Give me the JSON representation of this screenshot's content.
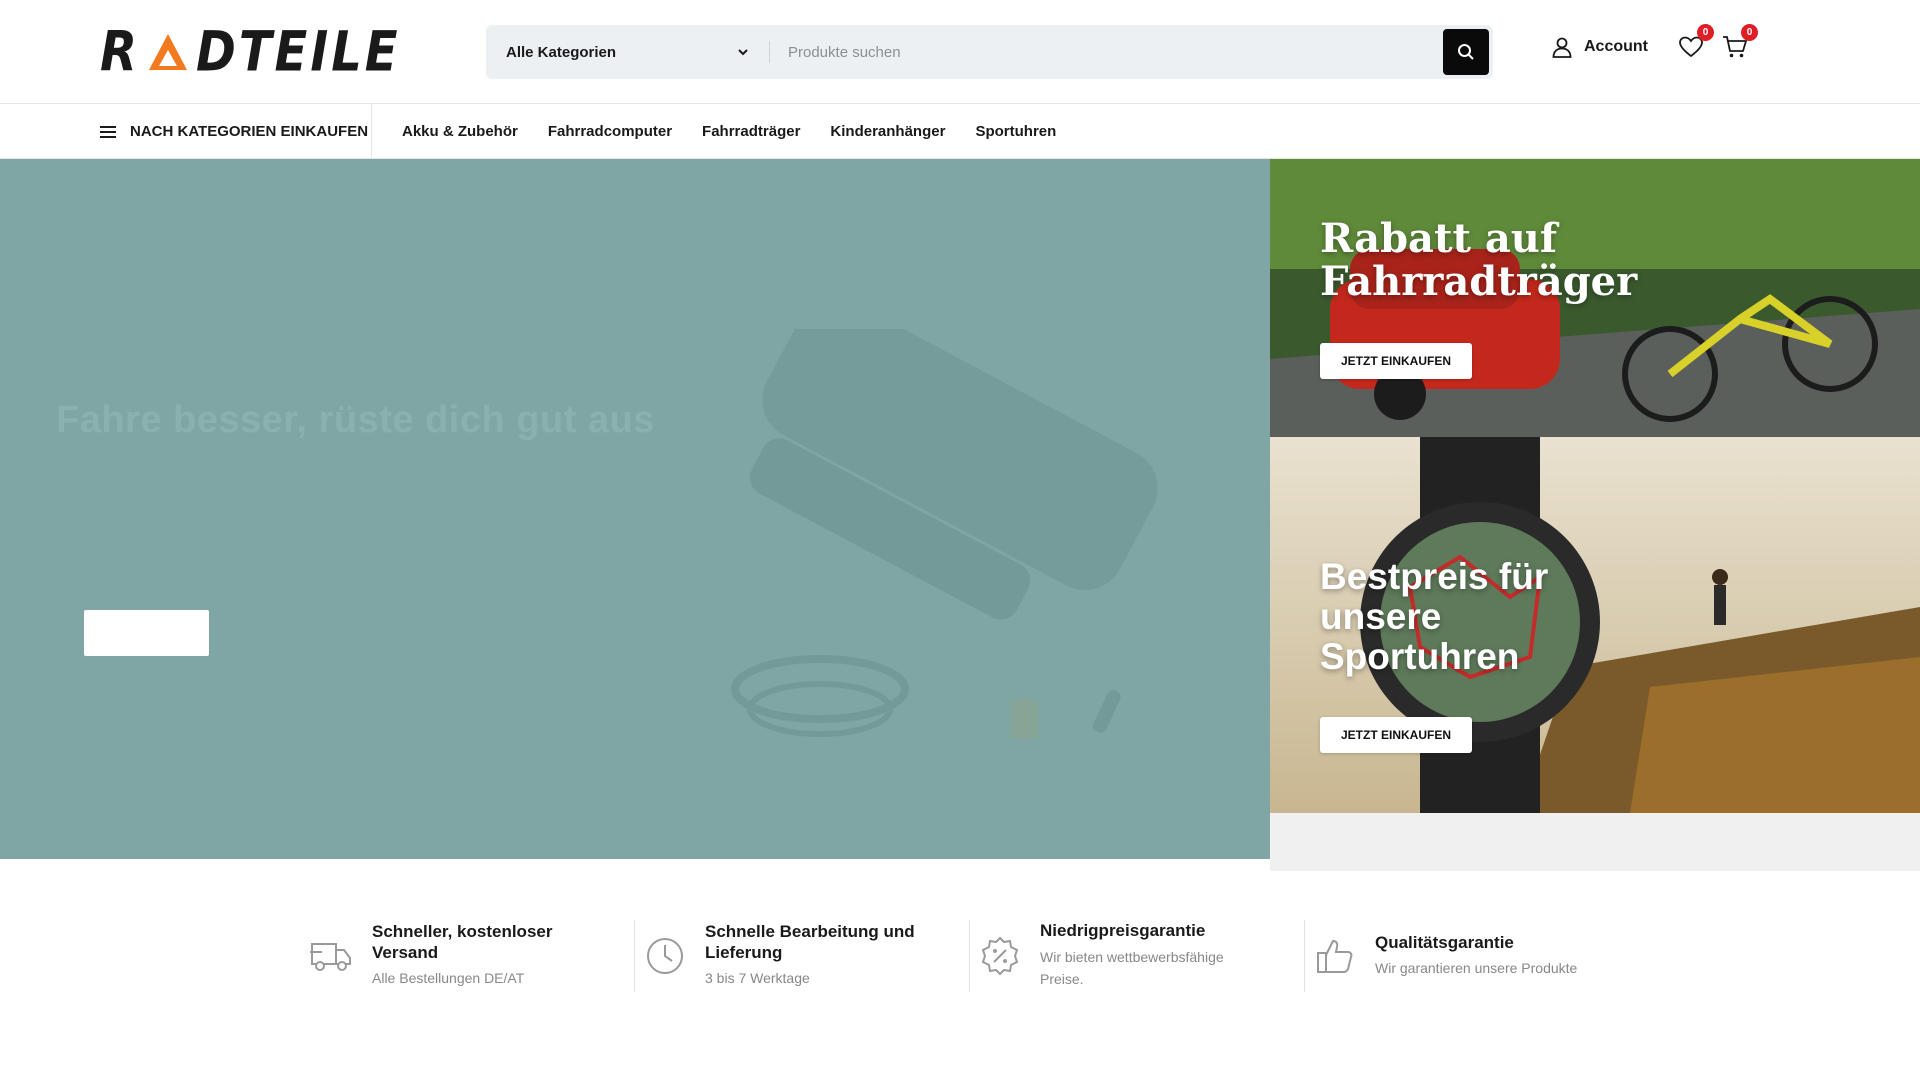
{
  "brand": {
    "logo_left": "R",
    "logo_right": "DTEILE",
    "accent": "#f47a20"
  },
  "search": {
    "category_label": "Alle Kategorien",
    "placeholder": "Produkte suchen"
  },
  "header_actions": {
    "account_label": "Account",
    "wishlist_count": "0",
    "cart_count": "0"
  },
  "nav": {
    "category_menu_label": "NACH KATEGORIEN EINKAUFEN",
    "links": [
      "Akku & Zubehör",
      "Fahrradcomputer",
      "Fahrradträger",
      "Kinderanhänger",
      "Sportuhren"
    ]
  },
  "hero": {
    "title": "Fahre besser, rüste dich gut aus",
    "bg_color": "#7fa5a5"
  },
  "banners": [
    {
      "title_line1": "Rabatt auf",
      "title_line2": "Fahrradträger",
      "button_label": "JETZT EINKAUFEN"
    },
    {
      "title_line1": "Bestpreis für",
      "title_line2": "unsere",
      "title_line3": "Sportuhren",
      "button_label": "JETZT EINKAUFEN"
    }
  ],
  "features": [
    {
      "icon": "truck-icon",
      "title": "Schneller, kostenloser Versand",
      "subtitle": "Alle Bestellungen DE/AT"
    },
    {
      "icon": "clock-icon",
      "title": "Schnelle Bearbeitung und Lieferung",
      "subtitle": "3 bis 7 Werktage"
    },
    {
      "icon": "discount-icon",
      "title": "Niedrigpreisgarantie",
      "subtitle": "Wir bieten wettbewerbsfähige Preise."
    },
    {
      "icon": "thumbs-up-icon",
      "title": "Qualitätsgarantie",
      "subtitle": "Wir garantieren unsere Produkte"
    }
  ]
}
